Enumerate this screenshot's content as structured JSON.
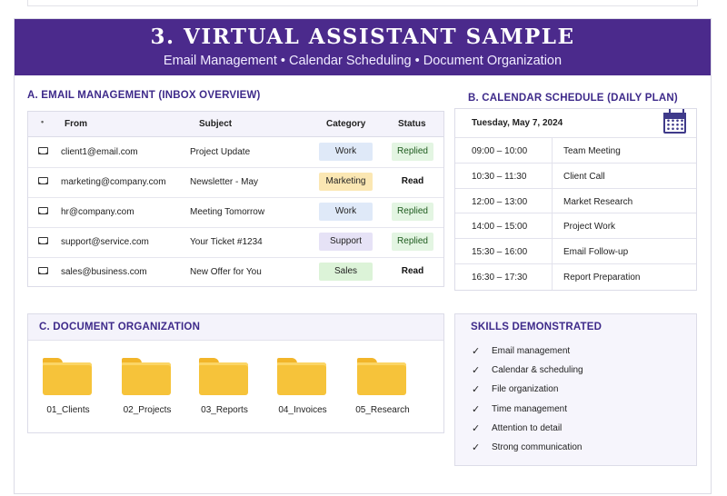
{
  "banner": {
    "title": "3. VIRTUAL ASSISTANT SAMPLE",
    "subtitle": "Email Management  •  Calendar Scheduling  •  Document Organization"
  },
  "email": {
    "section_title": "A. EMAIL MANAGEMENT (INBOX OVERVIEW)",
    "columns": [
      "From",
      "Subject",
      "Category",
      "Status"
    ],
    "rows": [
      {
        "from": "client1@email.com",
        "subject": "Project Update",
        "category": "Work",
        "status": "Replied"
      },
      {
        "from": "marketing@company.com",
        "subject": "Newsletter - May",
        "category": "Marketing",
        "status": "Read"
      },
      {
        "from": "hr@company.com",
        "subject": "Meeting Tomorrow",
        "category": "Work",
        "status": "Replied"
      },
      {
        "from": "support@service.com",
        "subject": "Your Ticket #1234",
        "category": "Support",
        "status": "Replied"
      },
      {
        "from": "sales@business.com",
        "subject": "New Offer for You",
        "category": "Sales",
        "status": "Read"
      }
    ],
    "category_colors": {
      "Work": "#dfe9f8",
      "Marketing": "#fbe7b3",
      "Support": "#e6e2f6",
      "Sales": "#dcf3d8"
    }
  },
  "calendar": {
    "section_title": "B. CALENDAR SCHEDULE (DAILY PLAN)",
    "date": "Tuesday, May 7, 2024",
    "icon": "calendar-icon",
    "events": [
      {
        "time": "09:00 – 10:00",
        "task": "Team Meeting"
      },
      {
        "time": "10:30 – 11:30",
        "task": "Client Call"
      },
      {
        "time": "12:00 – 13:00",
        "task": "Market Research"
      },
      {
        "time": "14:00 – 15:00",
        "task": "Project Work"
      },
      {
        "time": "15:30 – 16:00",
        "task": "Email Follow-up"
      },
      {
        "time": "16:30 – 17:30",
        "task": "Report Preparation"
      }
    ]
  },
  "documents": {
    "section_title": "C. DOCUMENT ORGANIZATION",
    "folders": [
      "01_Clients",
      "02_Projects",
      "03_Reports",
      "04_Invoices",
      "05_Research"
    ]
  },
  "skills": {
    "section_title": "SKILLS DEMONSTRATED",
    "items": [
      "Email management",
      "Calendar & scheduling",
      "File organization",
      "Time management",
      "Attention to detail",
      "Strong communication"
    ]
  },
  "colors": {
    "banner": "#4b2a8c",
    "section_title": "#3e2a8a",
    "folder": "#f6c33a"
  }
}
